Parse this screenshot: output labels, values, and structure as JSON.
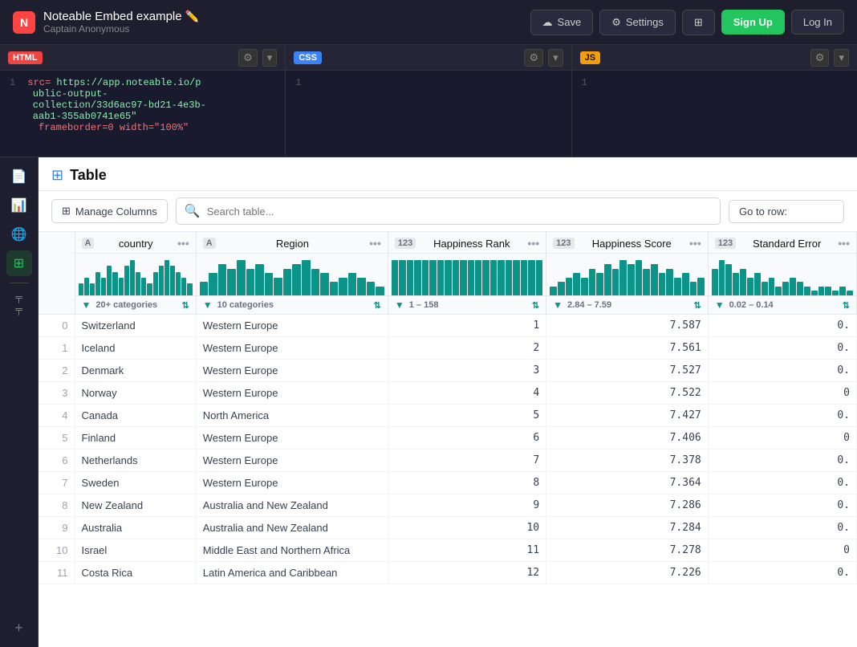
{
  "nav": {
    "logo_text": "N",
    "title": "Noteable Embed example",
    "subtitle": "Captain Anonymous",
    "save_label": "Save",
    "settings_label": "Settings",
    "signup_label": "Sign Up",
    "login_label": "Log In"
  },
  "code_panels": {
    "html": {
      "lang": "HTML",
      "line_num": "1",
      "code": "src= https://app.noteable.io/public-output-collection/33d6ac97-bd21-4e3b-aab1-355ab0741e65\" frameborder=0 width=\"100%\""
    },
    "css": {
      "lang": "CSS",
      "line_num": "1",
      "code": ""
    },
    "js": {
      "lang": "JS",
      "line_num": "1",
      "code": ""
    }
  },
  "page": {
    "title": "Table"
  },
  "toolbar": {
    "manage_columns": "Manage Columns",
    "search_placeholder": "Search table...",
    "goto_row_label": "Go to row:"
  },
  "columns": [
    {
      "type": "A",
      "name": "country",
      "stats": "20+ categories",
      "bars": [
        2,
        3,
        2,
        4,
        3,
        5,
        4,
        3,
        5,
        6,
        4,
        3,
        2,
        4,
        5,
        6,
        5,
        4,
        3,
        2
      ]
    },
    {
      "type": "A",
      "name": "Region",
      "stats": "10 categories",
      "bars": [
        3,
        5,
        7,
        6,
        8,
        6,
        7,
        5,
        4,
        6,
        7,
        8,
        6,
        5,
        3,
        4,
        5,
        4,
        3,
        2
      ]
    },
    {
      "type": "123",
      "name": "Happiness Rank",
      "stats": "1 – 158",
      "bars": [
        8,
        8,
        8,
        8,
        8,
        8,
        8,
        8,
        8,
        8,
        8,
        8,
        8,
        8,
        8,
        8,
        8,
        8,
        8,
        8
      ]
    },
    {
      "type": "123",
      "name": "Happiness Score",
      "stats": "2.84 – 7.59",
      "bars": [
        2,
        3,
        4,
        5,
        4,
        6,
        5,
        7,
        6,
        8,
        7,
        8,
        6,
        7,
        5,
        6,
        4,
        5,
        3,
        4
      ]
    },
    {
      "type": "123",
      "name": "Standard Error",
      "stats": "0.02 – 0.14",
      "bars": [
        6,
        8,
        7,
        5,
        6,
        4,
        5,
        3,
        4,
        2,
        3,
        4,
        3,
        2,
        1,
        2,
        2,
        1,
        2,
        1
      ]
    }
  ],
  "rows": [
    {
      "idx": 0,
      "country": "Switzerland",
      "region": "Western Europe",
      "rank": 1,
      "score": "7.587",
      "std_err": "0."
    },
    {
      "idx": 1,
      "country": "Iceland",
      "region": "Western Europe",
      "rank": 2,
      "score": "7.561",
      "std_err": "0."
    },
    {
      "idx": 2,
      "country": "Denmark",
      "region": "Western Europe",
      "rank": 3,
      "score": "7.527",
      "std_err": "0."
    },
    {
      "idx": 3,
      "country": "Norway",
      "region": "Western Europe",
      "rank": 4,
      "score": "7.522",
      "std_err": "0"
    },
    {
      "idx": 4,
      "country": "Canada",
      "region": "North America",
      "rank": 5,
      "score": "7.427",
      "std_err": "0."
    },
    {
      "idx": 5,
      "country": "Finland",
      "region": "Western Europe",
      "rank": 6,
      "score": "7.406",
      "std_err": "0"
    },
    {
      "idx": 6,
      "country": "Netherlands",
      "region": "Western Europe",
      "rank": 7,
      "score": "7.378",
      "std_err": "0."
    },
    {
      "idx": 7,
      "country": "Sweden",
      "region": "Western Europe",
      "rank": 8,
      "score": "7.364",
      "std_err": "0."
    },
    {
      "idx": 8,
      "country": "New Zealand",
      "region": "Australia and New Zealand",
      "rank": 9,
      "score": "7.286",
      "std_err": "0."
    },
    {
      "idx": 9,
      "country": "Australia",
      "region": "Australia and New Zealand",
      "rank": 10,
      "score": "7.284",
      "std_err": "0."
    },
    {
      "idx": 10,
      "country": "Israel",
      "region": "Middle East and Northern Africa",
      "rank": 11,
      "score": "7.278",
      "std_err": "0"
    },
    {
      "idx": 11,
      "country": "Costa Rica",
      "region": "Latin America and Caribbean",
      "rank": 12,
      "score": "7.226",
      "std_err": "0."
    }
  ]
}
